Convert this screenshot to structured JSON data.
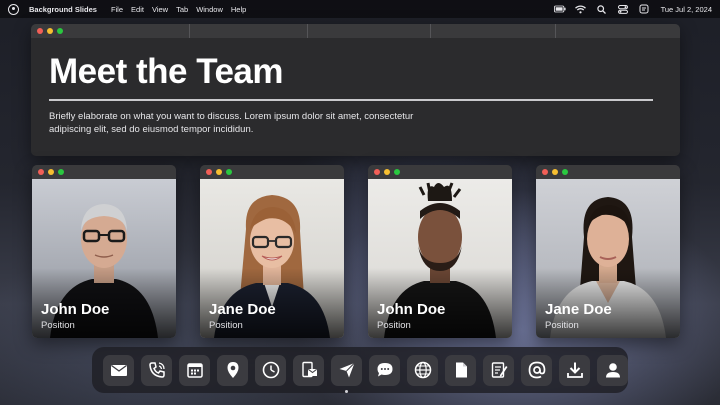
{
  "menubar": {
    "app_name": "Background Slides",
    "items": [
      "File",
      "Edit",
      "View",
      "Tab",
      "Window",
      "Help"
    ],
    "date": "Tue  Jul 2, 2024"
  },
  "header": {
    "title": "Meet the Team",
    "description": "Briefly elaborate on what you want to discuss. Lorem ipsum dolor sit amet, consectetur adipiscing elit, sed do eiusmod tempor incididun."
  },
  "team": [
    {
      "name": "John Doe",
      "position": "Position"
    },
    {
      "name": "Jane Doe",
      "position": "Position"
    },
    {
      "name": "John Doe",
      "position": "Position"
    },
    {
      "name": "Jane Doe",
      "position": "Position"
    }
  ],
  "dock": {
    "icons": [
      "mail-icon",
      "phone-icon",
      "calendar-icon",
      "location-pin-icon",
      "clock-icon",
      "document-mail-icon",
      "send-icon",
      "chat-icon",
      "globe-icon",
      "file-icon",
      "note-icon",
      "at-sign-icon",
      "download-icon",
      "user-icon"
    ],
    "active_index": 6
  },
  "colors": {
    "window_body": "#2b2b2d",
    "titlebar": "#3a3a3c",
    "close": "#f25f57",
    "minimize": "#f7bf31",
    "maximize": "#2ac840"
  }
}
